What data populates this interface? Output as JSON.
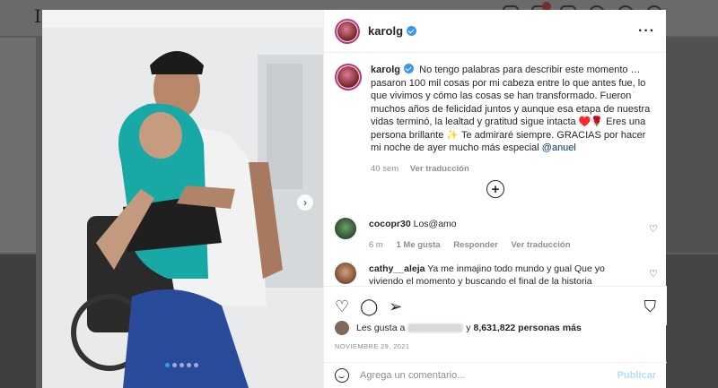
{
  "background": {
    "logo": "Inst"
  },
  "post": {
    "username": "karolg",
    "more_icon": "more-horizontal-icon",
    "caption": {
      "username": "karolg",
      "text": "No tengo palabras para describir este momento … pasaron 100 mil cosas por mi cabeza entre lo que antes fue, lo que vivimos y cómo las cosas se han transformado. Fueron muchos años de felicidad juntos y aunque esa etapa de nuestra vidas terminó, la lealtad y gratitud sigue intacta ♥️🌹 Eres una persona brillante ✨ Te admiraré siempre. GRACIAS por hacer mi noche de ayer mucho más especial",
      "mention": "@anuel",
      "time": "40 sem",
      "translate": "Ver traducción"
    },
    "load_more_icon": "plus-circle-icon",
    "comments": [
      {
        "username": "cocopr30",
        "text": "Los@amo",
        "time": "6 m",
        "likes": "1 Me gusta",
        "reply": "Responder",
        "translate": "Ver traducción"
      },
      {
        "username": "cathy__aleja",
        "text": "Ya me inmajino todo mundo y gual Que yo viviendo el momento y buscando el final de la historia"
      }
    ],
    "likes": {
      "prefix": "Les gusta a",
      "conjunction": "y",
      "count": "8,631,822 personas más"
    },
    "date": "NOVIEMBRE 29, 2021",
    "add_comment": {
      "placeholder": "Agrega un comentario...",
      "publish": "Publicar"
    },
    "carousel": {
      "total": 5,
      "active": 1
    }
  }
}
